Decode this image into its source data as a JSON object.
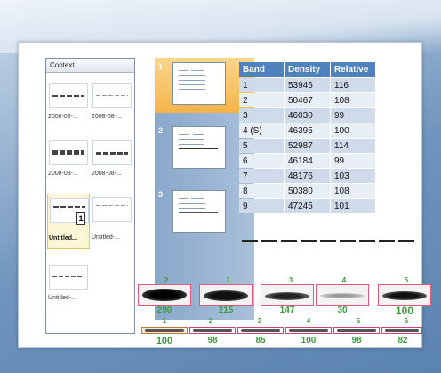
{
  "context_panel": {
    "title": "Context",
    "items": [
      {
        "label": "2008-08-..."
      },
      {
        "label": "2008-08-..."
      },
      {
        "label": "2008-08-..."
      },
      {
        "label": "2008-08-..."
      },
      {
        "label": "Untitled...",
        "badge": "1"
      },
      {
        "label": "Untitled-..."
      },
      {
        "label": "Untitled-..."
      }
    ]
  },
  "slides_panel": {
    "slides": [
      {
        "number": "1"
      },
      {
        "number": "2"
      },
      {
        "number": "3"
      }
    ]
  },
  "table": {
    "headers": [
      "Band",
      "Density",
      "Relative"
    ],
    "rows": [
      [
        "1",
        "53946",
        "116"
      ],
      [
        "2",
        "50467",
        "108"
      ],
      [
        "3",
        "46030",
        "99"
      ],
      [
        "4 (S)",
        "46395",
        "100"
      ],
      [
        "5",
        "52987",
        "114"
      ],
      [
        "6",
        "46184",
        "99"
      ],
      [
        "7",
        "48176",
        "103"
      ],
      [
        "8",
        "50380",
        "108"
      ],
      [
        "9",
        "47245",
        "101"
      ]
    ]
  },
  "blot_top": {
    "lanes": [
      {
        "number": "2",
        "value": "290"
      },
      {
        "number": "1",
        "value": "215"
      },
      {
        "number": "3",
        "value": "147"
      },
      {
        "number": "4",
        "value": "30"
      },
      {
        "number": "5",
        "value": "100"
      }
    ]
  },
  "blot_bottom": {
    "lanes": [
      {
        "number": "1",
        "value": "100"
      },
      {
        "number": "2",
        "value": "98"
      },
      {
        "number": "3",
        "value": "85"
      },
      {
        "number": "4",
        "value": "100"
      },
      {
        "number": "5",
        "value": "98"
      },
      {
        "number": "6",
        "value": "82"
      }
    ]
  },
  "colors": {
    "header_blue": "#4f81bd",
    "value_green": "#3c9a3c",
    "box_pink": "#e05a7a",
    "active_slide": "#f5b34a"
  }
}
